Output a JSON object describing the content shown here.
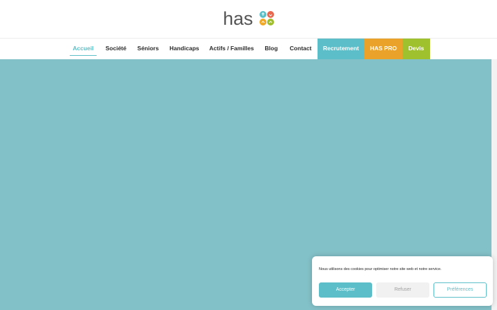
{
  "logo": {
    "text": "has",
    "icons": [
      "man-icon",
      "heart-icon",
      "house-icon",
      "house-icon"
    ],
    "colors": {
      "text": "#555555",
      "icons": [
        "#5bbfc7",
        "#e8674f",
        "#f1a726",
        "#9fbe2c"
      ]
    }
  },
  "nav": {
    "items": [
      {
        "label": "Accueil",
        "active": true
      },
      {
        "label": "Société"
      },
      {
        "label": "Séniors"
      },
      {
        "label": "Handicaps"
      },
      {
        "label": "Actifs / Familles"
      },
      {
        "label": "Blog"
      },
      {
        "label": "Contact"
      },
      {
        "label": "Recrutement",
        "bg": "#5cbec8"
      },
      {
        "label": "HAS PRO",
        "bg": "#eba22a"
      },
      {
        "label": "Devis",
        "bg": "#a0c12e"
      }
    ],
    "colors": {
      "active": "#5bbfc7",
      "text": "#2b2b2b"
    }
  },
  "hero": {
    "color": "#83c1c8"
  },
  "cookie": {
    "text": "Nous utilisons des cookies pour optimiser notre site web et notre service.",
    "accept": "Accepter",
    "refuse": "Refuser",
    "preferences": "Préférences",
    "colors": {
      "accent": "#5cbec8"
    }
  }
}
